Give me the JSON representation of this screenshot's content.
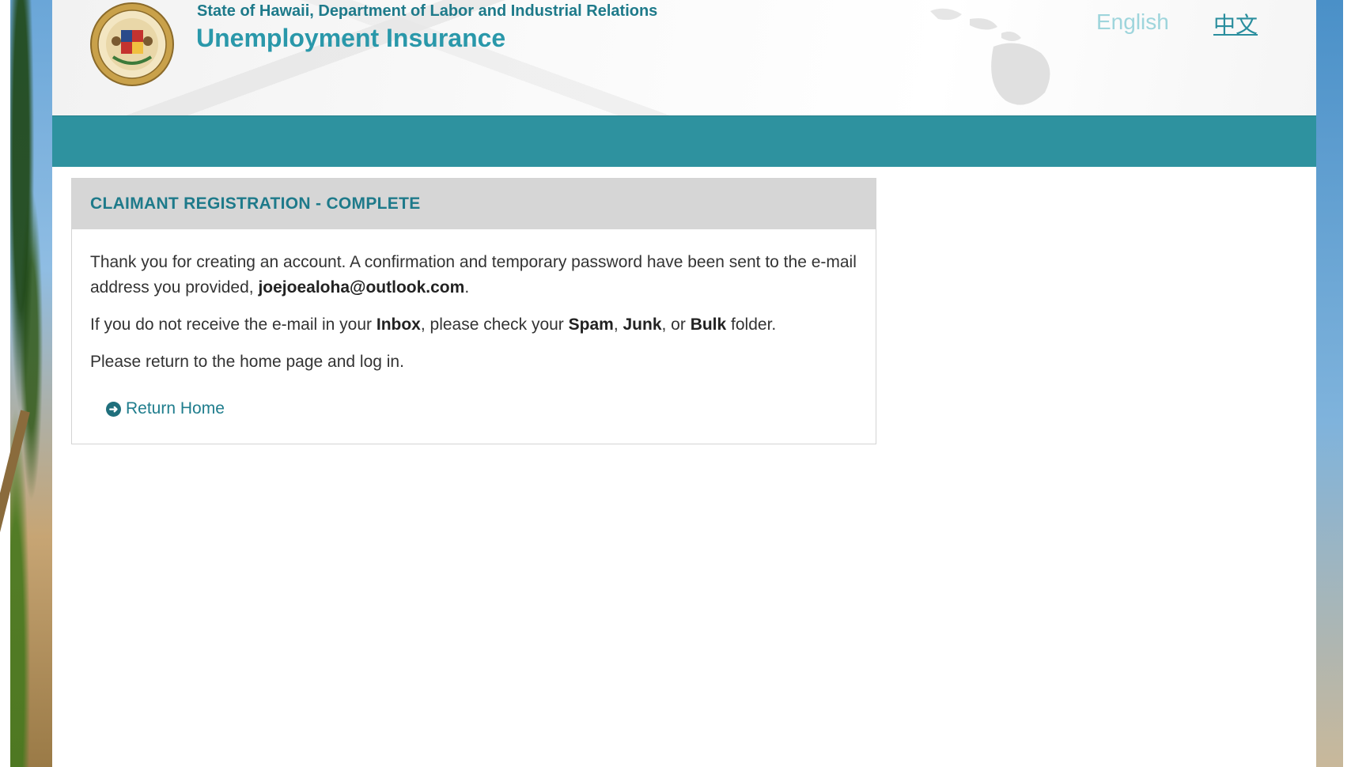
{
  "header": {
    "org_name": "State of Hawaii, Department of Labor and Industrial Relations",
    "site_title": "Unemployment Insurance",
    "lang_english": "English",
    "lang_chinese": "中文"
  },
  "panel": {
    "heading": "CLAIMANT REGISTRATION - COMPLETE",
    "para1_text": "Thank you for creating an account. A confirmation and temporary password have been sent to the e-mail address you provided, ",
    "email": "joejoealoha@outlook.com",
    "para1_end": ".",
    "para2_start": "If you do not receive the e-mail in your ",
    "inbox": "Inbox",
    "para2_mid1": ", please check your ",
    "spam": "Spam",
    "comma": ", ",
    "junk": "Junk",
    "para2_mid2": ", or ",
    "bulk": "Bulk",
    "para2_end": " folder.",
    "para3": "Please return to the home page and log in.",
    "return_home_label": "Return Home"
  },
  "colors": {
    "teal_bar": "#2e929f",
    "heading_text": "#1e7a8a",
    "panel_heading_bg": "#d6d6d6"
  },
  "icons": {
    "seal": "state-seal-icon",
    "return": "arrow-circle-right-icon"
  }
}
